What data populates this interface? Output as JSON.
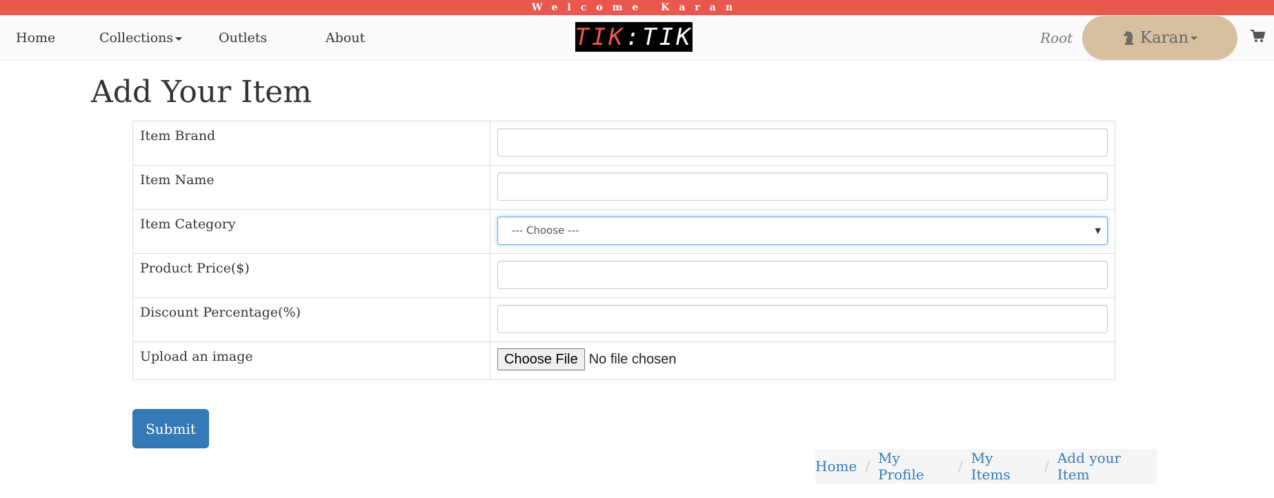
{
  "welcome_bar": {
    "text": "Welcome Karan",
    "color": "#e9584f"
  },
  "nav": {
    "home": "Home",
    "collections": "Collections",
    "outlets": "Outlets",
    "about": "About",
    "logo": {
      "left": "TIK",
      "colon": ":",
      "right": "TIK"
    },
    "root": "Root",
    "user": "Karan",
    "user_icon": "chess-knight-icon",
    "cart_icon": "cart-icon",
    "user_pill_color": "#d7c0a0"
  },
  "page": {
    "title": "Add Your Item"
  },
  "form": {
    "fields": [
      {
        "label": "Item Brand",
        "type": "text",
        "value": ""
      },
      {
        "label": "Item Name",
        "type": "text",
        "value": ""
      },
      {
        "label": "Item Category",
        "type": "select",
        "selected": "--- Choose ---"
      },
      {
        "label": "Product Price($)",
        "type": "text",
        "value": ""
      },
      {
        "label": "Discount Percentage(%)",
        "type": "text",
        "value": ""
      },
      {
        "label": "Upload an image",
        "type": "file",
        "button": "Choose File",
        "status": "No file chosen"
      }
    ],
    "submit": "Submit",
    "submit_color": "#337ab7"
  },
  "breadcrumb": {
    "items": [
      "Home",
      "My Profile",
      "My Items",
      "Add your Item"
    ],
    "separator": "/"
  }
}
